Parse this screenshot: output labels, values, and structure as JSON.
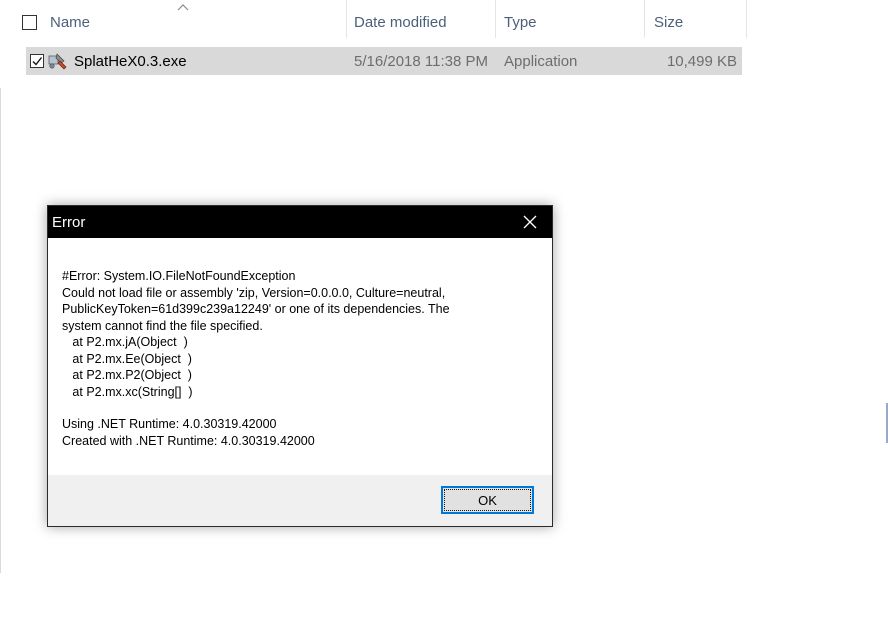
{
  "explorer": {
    "columns": {
      "name": "Name",
      "date_modified": "Date modified",
      "type": "Type",
      "size": "Size"
    },
    "files": [
      {
        "name": "SplatHeX0.3.exe",
        "date_modified": "5/16/2018 11:38 PM",
        "type": "Application",
        "size": "10,499 KB",
        "checked": true,
        "icon": "application-icon"
      }
    ],
    "sort_indicator": "sort-up-caret-icon"
  },
  "dialog": {
    "title": "Error",
    "close_icon": "close-icon",
    "message_lines": [
      "#Error: System.IO.FileNotFoundException",
      "Could not load file or assembly 'zip, Version=0.0.0.0, Culture=neutral,",
      "PublicKeyToken=61d399c239a12249' or one of its dependencies. The",
      "system cannot find the file specified.",
      "   at P2.mx.jA(Object  )",
      "   at P2.mx.Ee(Object  )",
      "   at P2.mx.P2(Object  )",
      "   at P2.mx.xc(String[]  )",
      "",
      "Using .NET Runtime: 4.0.30319.42000",
      "Created with .NET Runtime: 4.0.30319.42000"
    ],
    "ok_label": "OK"
  },
  "colors": {
    "header_text": "#4c607a",
    "selected_row": "#d9d9d9",
    "dialog_titlebar": "#000000",
    "button_focus": "#0078d7"
  }
}
